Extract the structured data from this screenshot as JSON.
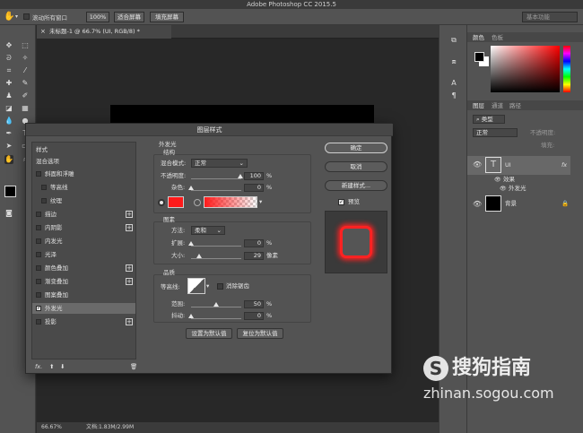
{
  "app": {
    "title": "Adobe Photoshop CC 2015.5"
  },
  "options_bar": {
    "scroll_all_label": "滚动所有窗口",
    "zoom_label": "100%",
    "fit_screen_label": "适合屏幕",
    "fill_screen_label": "填充屏幕",
    "workspace_label": "基本功能"
  },
  "document": {
    "tab_title": "未标题-1 @ 66.7% (UI, RGB/8) *",
    "status_zoom": "66.67%",
    "status_doc": "文档:1.83M/2.99M"
  },
  "right_panel": {
    "color_tab": "颜色",
    "swatches_tab": "色板",
    "layers_tab": "图层",
    "channels_tab": "通道",
    "paths_tab": "路径",
    "kind_label": "类型",
    "blend_label": "正常",
    "opacity_label": "不透明度:",
    "fill_label": "填充:",
    "layers": [
      {
        "name": "UI",
        "fx": "fx"
      },
      {
        "name": "效果"
      },
      {
        "name": "外发光"
      },
      {
        "name": "背景"
      }
    ]
  },
  "dialog": {
    "title": "图层样式",
    "styles_header": "样式",
    "blend_options": "混合选项",
    "style_items": [
      "斜面和浮雕",
      "等高线",
      "纹理",
      "描边",
      "内阴影",
      "内发光",
      "光泽",
      "颜色叠加",
      "渐变叠加",
      "图案叠加",
      "外发光",
      "投影"
    ],
    "fx_label": "fx.",
    "outer_glow_title": "外发光",
    "structure_title": "结构",
    "blend_mode_label": "混合模式:",
    "blend_mode_value": "正常",
    "opacity_label": "不透明度:",
    "opacity_value": "100",
    "noise_label": "杂色:",
    "noise_value": "0",
    "percent": "%",
    "elements_title": "图素",
    "method_label": "方法:",
    "method_value": "柔和",
    "spread_label": "扩展:",
    "spread_value": "0",
    "size_label": "大小:",
    "size_value": "29",
    "px_label": "像素",
    "quality_title": "品质",
    "contour_label": "等高线:",
    "antialias_label": "消除锯齿",
    "range_label": "范围:",
    "range_value": "50",
    "jitter_label": "抖动:",
    "jitter_value": "0",
    "set_default": "设置为默认值",
    "reset_default": "复位为默认值",
    "ok": "确定",
    "cancel": "取消",
    "new_style": "新建样式...",
    "preview": "预览",
    "glow_color": "#ff1a1a"
  },
  "watermark": {
    "brand": "搜狗指南",
    "url": "zhinan.sogou.com"
  }
}
